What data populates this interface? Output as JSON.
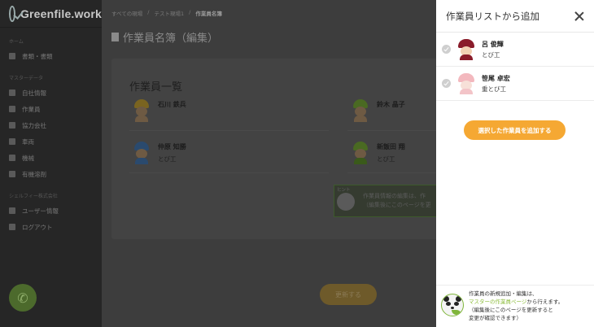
{
  "sidebar": {
    "logo": "Greenfile.work",
    "sections": [
      {
        "label": "ホーム",
        "items": [
          {
            "label": "書類・書類",
            "icon": "document-icon"
          }
        ]
      },
      {
        "label": "マスターデータ",
        "items": [
          {
            "label": "自社情報",
            "icon": "building-icon"
          },
          {
            "label": "作業員",
            "icon": "users-icon"
          },
          {
            "label": "協力会社",
            "icon": "company-icon"
          },
          {
            "label": "車両",
            "icon": "car-icon"
          },
          {
            "label": "機械",
            "icon": "gear-icon"
          },
          {
            "label": "有機溶剤",
            "icon": "flask-icon"
          }
        ]
      },
      {
        "label": "シェルフィー株式会社",
        "items": [
          {
            "label": "ユーザー情報",
            "icon": "user-card-icon"
          },
          {
            "label": "ログアウト",
            "icon": "power-icon"
          }
        ]
      }
    ]
  },
  "main": {
    "breadcrumb": [
      "すべての現場",
      "テスト現場1",
      "作業員名簿"
    ],
    "page_title": "作業員名簿（編集）",
    "card_title": "作業員一覧",
    "workers": [
      {
        "name": "石川 鉄兵",
        "trade": ""
      },
      {
        "name": "鈴木 晶子",
        "trade": ""
      },
      {
        "name": "仲原 知勝",
        "trade": "とび工"
      },
      {
        "name": "新飯田 翔",
        "trade": "とび工"
      }
    ],
    "hint_label": "ヒント",
    "hint_lines": [
      "作業員情報の編集は、作",
      "（編集後にこのページを更"
    ],
    "update_button": "更新する"
  },
  "panel": {
    "title": "作業員リストから追加",
    "workers": [
      {
        "name": "呂 俊輝",
        "trade": "とび工"
      },
      {
        "name": "笹尾 卓宏",
        "trade": "重とび工"
      }
    ],
    "add_button": "選択した作業員を追加する",
    "footer": {
      "line1": "作業員の新規追加・編集は、",
      "link": "マスターの作業員ページ",
      "link_suffix": "から行えます。",
      "line3": "（編集後にこのページを更新すると",
      "line4": "変更が確認できます）"
    }
  },
  "colors": {
    "accent_orange": "#f5a833",
    "brand_green": "#8dbd3c",
    "overlay": "#3d3d3d"
  }
}
